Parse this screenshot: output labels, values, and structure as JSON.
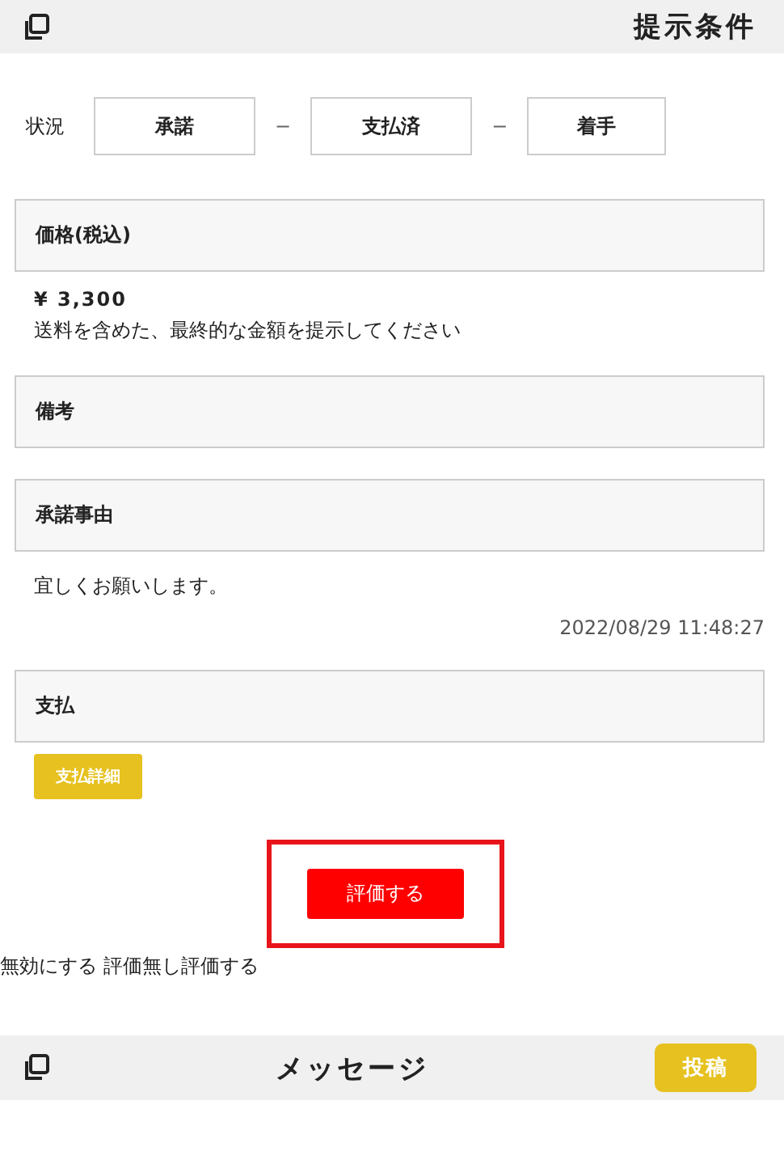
{
  "header": {
    "title": "提示条件"
  },
  "status": {
    "label": "状況",
    "separator": "−",
    "steps": [
      {
        "label": "承諾"
      },
      {
        "label": "支払済"
      },
      {
        "label": "着手"
      }
    ]
  },
  "sections": [
    {
      "title": "価格(税込)",
      "price": "¥ 3,300",
      "note": "送料を含めた、最終的な金額を提示してください"
    },
    {
      "title": "備考"
    },
    {
      "title": "承諾事由",
      "body": "宜しくお願いします。",
      "timestamp": "2022/08/29 11:48:27"
    },
    {
      "title": "支払",
      "button": "支払詳細"
    }
  ],
  "rating": {
    "button": "評価する",
    "highlighted": true,
    "text": "無効にする 評価無し評価する"
  },
  "footer": {
    "title": "メッセージ",
    "button": "投稿"
  }
}
